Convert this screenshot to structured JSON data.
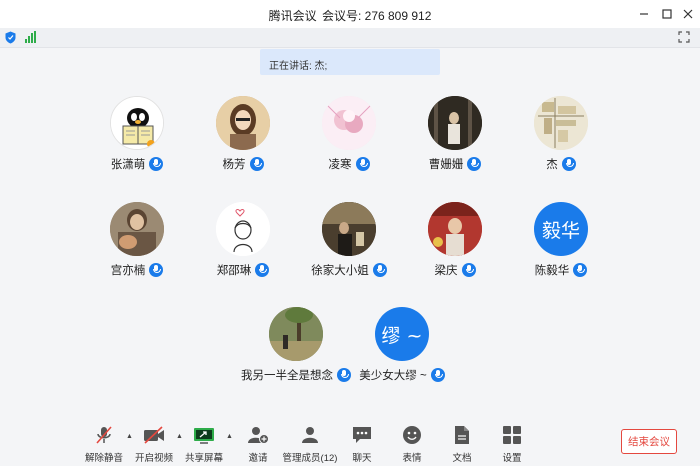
{
  "window": {
    "app_name": "腾讯会议",
    "meeting_id_label": "会议号:",
    "meeting_id": "276 809 912",
    "controls": [
      "minimize",
      "maximize",
      "close"
    ]
  },
  "status": {
    "icons": [
      "shield-icon",
      "signal-icon",
      "fullscreen-icon"
    ]
  },
  "speaking": {
    "text": "正在讲话: 杰;"
  },
  "participants": [
    {
      "name": "张潇萌",
      "avatar": "penguin-photo"
    },
    {
      "name": "杨芳",
      "avatar": "photo"
    },
    {
      "name": "凌寒",
      "avatar": "photo"
    },
    {
      "name": "曹姗姗",
      "avatar": "photo"
    },
    {
      "name": "杰",
      "avatar": "map-photo"
    },
    {
      "name": "宫亦楠",
      "avatar": "photo"
    },
    {
      "name": "郑邵琳",
      "avatar": "drawing"
    },
    {
      "name": "徐家大小姐",
      "avatar": "photo"
    },
    {
      "name": "梁庆",
      "avatar": "photo"
    },
    {
      "name": "陈毅华",
      "avatar_text": "毅华"
    },
    {
      "name": "我另一半全是想念",
      "avatar": "photo"
    },
    {
      "name": "美少女大缪 ~",
      "avatar_text": "缪 ~"
    }
  ],
  "toolbar": {
    "unmute": "解除静音",
    "start_video": "开启视频",
    "share_screen": "共享屏幕",
    "invite": "邀请",
    "manage_members": "管理成员(12)",
    "chat": "聊天",
    "reactions": "表情",
    "docs": "文档",
    "settings": "设置",
    "end_meeting": "结束会议"
  },
  "colors": {
    "accent": "#1a7bea",
    "end": "#e4483f",
    "signal": "#2eac4a"
  }
}
